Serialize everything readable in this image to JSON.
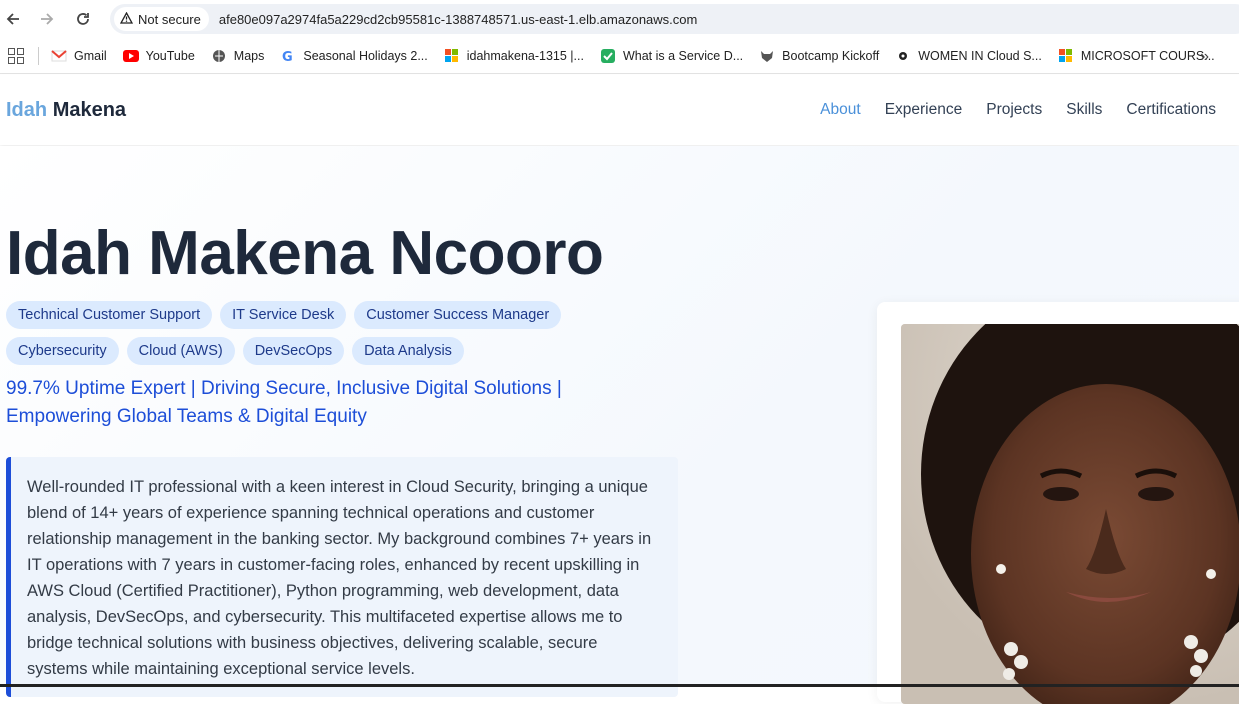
{
  "browser": {
    "security_label": "Not secure",
    "url": "afe80e097a2974fa5a229cd2cb95581c-1388748571.us-east-1.elb.amazonaws.com",
    "bookmarks": [
      {
        "label": "Gmail",
        "icon": "gmail-icon"
      },
      {
        "label": "YouTube",
        "icon": "youtube-icon"
      },
      {
        "label": "Maps",
        "icon": "maps-icon"
      },
      {
        "label": "Seasonal Holidays 2...",
        "icon": "google-icon"
      },
      {
        "label": "idahmakena-1315 |...",
        "icon": "microsoft-icon"
      },
      {
        "label": "What is a Service D...",
        "icon": "checklist-icon"
      },
      {
        "label": "Bootcamp Kickoff",
        "icon": "fox-icon"
      },
      {
        "label": "WOMEN IN Cloud S...",
        "icon": "dot-icon"
      },
      {
        "label": "MICROSOFT COURS...",
        "icon": "microsoft-icon"
      }
    ]
  },
  "site": {
    "brand_first": "Idah",
    "brand_last": "Makena",
    "nav": [
      "About",
      "Experience",
      "Projects",
      "Skills",
      "Certifications"
    ],
    "active_nav": "About"
  },
  "hero": {
    "name": "Idah Makena Ncooro",
    "tags": [
      "Technical Customer Support",
      "IT Service Desk",
      "Customer Success Manager",
      "Cybersecurity",
      "Cloud (AWS)",
      "DevSecOps",
      "Data Analysis"
    ],
    "tagline": "99.7% Uptime Expert | Driving Secure, Inclusive Digital Solutions | Empowering Global Teams & Digital Equity",
    "about": "Well-rounded IT professional with a keen interest in Cloud Security, bringing a unique blend of 14+ years of experience spanning technical operations and customer relationship management in the banking sector. My background combines 7+ years in IT operations with 7 years in customer-facing roles, enhanced by recent upskilling in AWS Cloud (Certified Practitioner), Python programming, web development, data analysis, DevSecOps, and cybersecurity. This multifaceted expertise allows me to bridge technical solutions with business objectives, delivering scalable, secure systems while maintaining exceptional service levels."
  },
  "colors": {
    "accent": "#1d4ed8",
    "brand_first": "#6aa6dd",
    "tag_bg": "#dbeafe",
    "heading": "#1e293b"
  }
}
